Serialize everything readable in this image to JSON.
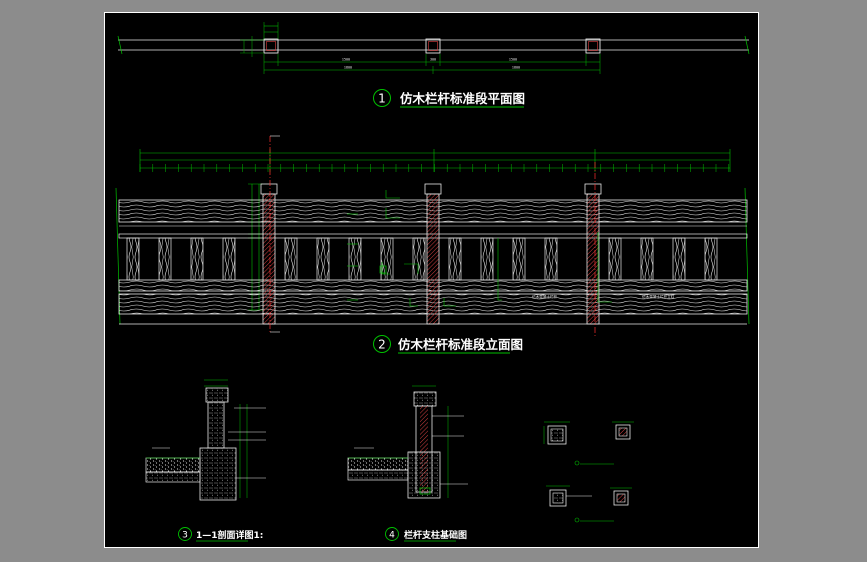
{
  "titles": {
    "t1": {
      "num": "1",
      "text": "仿木栏杆标准段平面图"
    },
    "t2": {
      "num": "2",
      "text": "仿木栏杆标准段立面图"
    },
    "t3": {
      "num": "3",
      "text": "1—1剖面详图1:"
    },
    "t4": {
      "num": "4",
      "text": "栏杆支柱基础图"
    }
  },
  "elevation_notes": {
    "n1": "仿木混凝土栏杆",
    "n2": "仿木混凝土栏杆立柱"
  },
  "plan_dims": {
    "total": "1800",
    "seg": [
      "1500",
      "300",
      "1500"
    ]
  },
  "colors": {
    "sheet": "#000000",
    "frame": "#ffffff",
    "line": "#00c000",
    "dim": "#d0d0d0",
    "wood": "#e8e8e8",
    "post": "#d04040",
    "axis": "#ff3030"
  }
}
